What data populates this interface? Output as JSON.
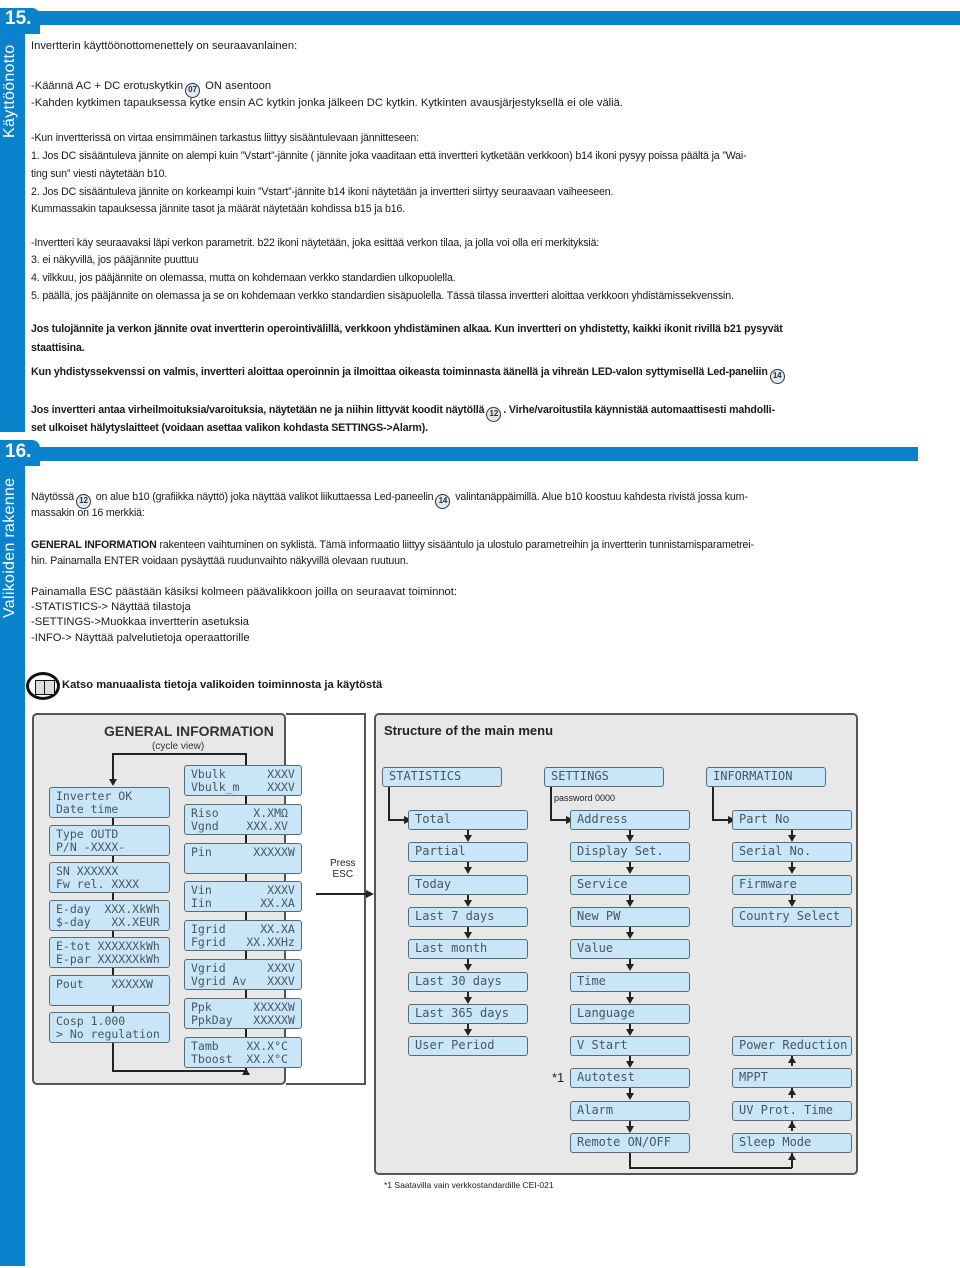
{
  "section15": {
    "number": "15.",
    "side_label": "Käyttöönotto",
    "intro": "Invertterin käyttöönottomenettely on seuraavanlainen:",
    "step1_pre": "-Käännä AC + DC erotuskytkin",
    "step1_badge": "07",
    "step1_post": " ON asentoon",
    "step2": "-Kahden kytkimen tapauksessa kytke ensin AC kytkin jonka jälkeen DC kytkin. Kytkinten avausjärjestyksellä ei ole väliä.",
    "check_intro": "-Kun invertterissä on virtaa ensimmäinen tarkastus liittyy sisääntulevaan jännitteseen:",
    "check1_a": "1. Jos DC sisääntuleva jännite on alempi kuin ”Vstart”-jännite ( jännite joka vaaditaan että invertteri kytketään verkkoon) b14 ikoni pysyy poissa päältä ja ”Wai-",
    "check1_b": "ting sun” viesti näytetään b10.",
    "check2": "2. Jos DC sisääntuleva jännite on korkeampi kuin ”Vstart”-jännite b14 ikoni näytetään ja invertteri siirtyy seuraavaan vaiheeseen.",
    "check_note": "Kummassakin tapauksessa jännite tasot ja määrät näytetään kohdissa b15 ja b16.",
    "grid_intro": "-Invertteri käy seuraavaksi läpi verkon parametrit. b22 ikoni näytetään, joka esittää verkon tilaa, ja jolla voi olla eri merkityksiä:",
    "grid3": "3. ei näkyvillä, jos pääjännite puuttuu",
    "grid4": "4. vilkkuu, jos pääjännite on olemassa, mutta on kohdemaan verkko standardien ulkopuolella.",
    "grid5": "5. päällä, jos pääjännite on olemassa ja se on kohdemaan verkko standardien sisäpuolella. Tässä tilassa invertteri aloittaa verkkoon yhdistämissekvenssin.",
    "bold1_a": "Jos tulojännite ja verkon jännite ovat invertterin operointivälillä, verkkoon yhdistäminen alkaa. Kun invertteri on yhdistetty, kaikki ikonit rivillä b21 pysyvät",
    "bold1_b": "staattisina.",
    "bold2": "Kun yhdistyssekvenssi on valmis, invertteri aloittaa operoinnin ja ilmoittaa oikeasta toiminnasta äänellä ja vihreän LED-valon syttymisellä Led-paneliin",
    "bold2_badge": "14",
    "bold3_a_pre": "Jos invertteri antaa virheilmoituksia/varoituksia, näytetään ne ja niihin littyvät koodit näytöllä",
    "bold3_badge": "12",
    "bold3_a_post": ". Virhe/varoitustila käynnistää automaattisesti mahdolli-",
    "bold3_b": "set ulkoiset hälytyslaitteet (voidaan asettaa valikon kohdasta SETTINGS->Alarm)."
  },
  "section16": {
    "number": "16.",
    "side_label": "Valikoiden rakenne",
    "p1_pre": "Näytössä",
    "p1_badge1": "12",
    "p1_mid": " on alue b10 (grafiikka näyttö) joka näyttää valikot liikuttaessa Led-paneelin",
    "p1_badge2": "14",
    "p1_post": " valintanäppäimillä. Alue b10 koostuu kahdesta rivistä jossa kum-",
    "p1_b": "massakin on 16 merkkiä:",
    "p2_bold": "GENERAL INFORMATION",
    "p2_rest": " rakenteen vaihtuminen on syklistä. Tämä informaatio liittyy sisääntulo ja ulostulo parametreihin ja invertterin tunnistamisparametrei-",
    "p2_b": "hin. Painamalla ENTER voidaan pysäyttää ruudunvaihto näkyvillä olevaan ruutuun.",
    "p3": "Painamalla ESC päästään käsiksi kolmeen päävalikkoon joilla on seuraavat toiminnot:",
    "p3_items": [
      "-STATISTICS-> Näyttää tilastoja",
      "-SETTINGS->Muokkaa invertterin asetuksia",
      "-INFO-> Näyttää palvelutietoja operaattorille"
    ],
    "manual_note": "Katso manuaalista tietoja valikoiden toiminnosta ja käytöstä"
  },
  "general_info": {
    "title": "GENERAL INFORMATION",
    "subtitle": "(cycle view)",
    "left_screens": [
      "Inverter OK\nDate time",
      "Type OUTD\nP/N -XXXX-",
      "SN XXXXXX\nFw rel. XXXX",
      "E-day  XXX.XkWh\n$-day   XX.XEUR",
      "E-tot XXXXXXkWh\nE-par XXXXXXkWh",
      "Pout    XXXXXW\n ",
      "Cosp 1.000\n> No regulation"
    ],
    "right_screens": [
      "Vbulk      XXXV\nVbulk_m    XXXV",
      "Riso     X.XMΩ\nVgnd    XXX.XV",
      "Pin      XXXXXW\n ",
      "Vin        XXXV\nIin       XX.XA",
      "Igrid     XX.XA\nFgrid   XX.XXHz",
      "Vgrid      XXXV\nVgrid Av   XXXV",
      "Ppk      XXXXXW\nPpkDay   XXXXXW",
      "Tamb    XX.X°C\nTboost  XX.X°C"
    ],
    "press_esc": "Press\nESC"
  },
  "main_menu": {
    "title": "Structure of the main menu",
    "password_note": "password 0000",
    "columns": [
      {
        "header": "STATISTICS",
        "items": [
          "Total",
          "Partial",
          "Today",
          "Last 7 days",
          "Last month",
          "Last 30 days",
          "Last 365 days",
          "User Period"
        ]
      },
      {
        "header": "SETTINGS",
        "items": [
          "Address",
          "Display Set.",
          "Service",
          "New PW",
          "Value",
          "Time",
          "Language",
          "V Start",
          "Autotest",
          "Alarm",
          "Remote ON/OFF"
        ]
      },
      {
        "header": "INFORMATION",
        "items": [
          "Part No",
          "Serial No.",
          "Firmware",
          "Country Select"
        ],
        "bottom_items": [
          "Power Reduction",
          "MPPT",
          "UV Prot. Time",
          "Sleep Mode"
        ]
      }
    ],
    "autotest_marker": "*1",
    "footnote": "*1 Saatavilla vain verkkostandardille CEI-021"
  }
}
